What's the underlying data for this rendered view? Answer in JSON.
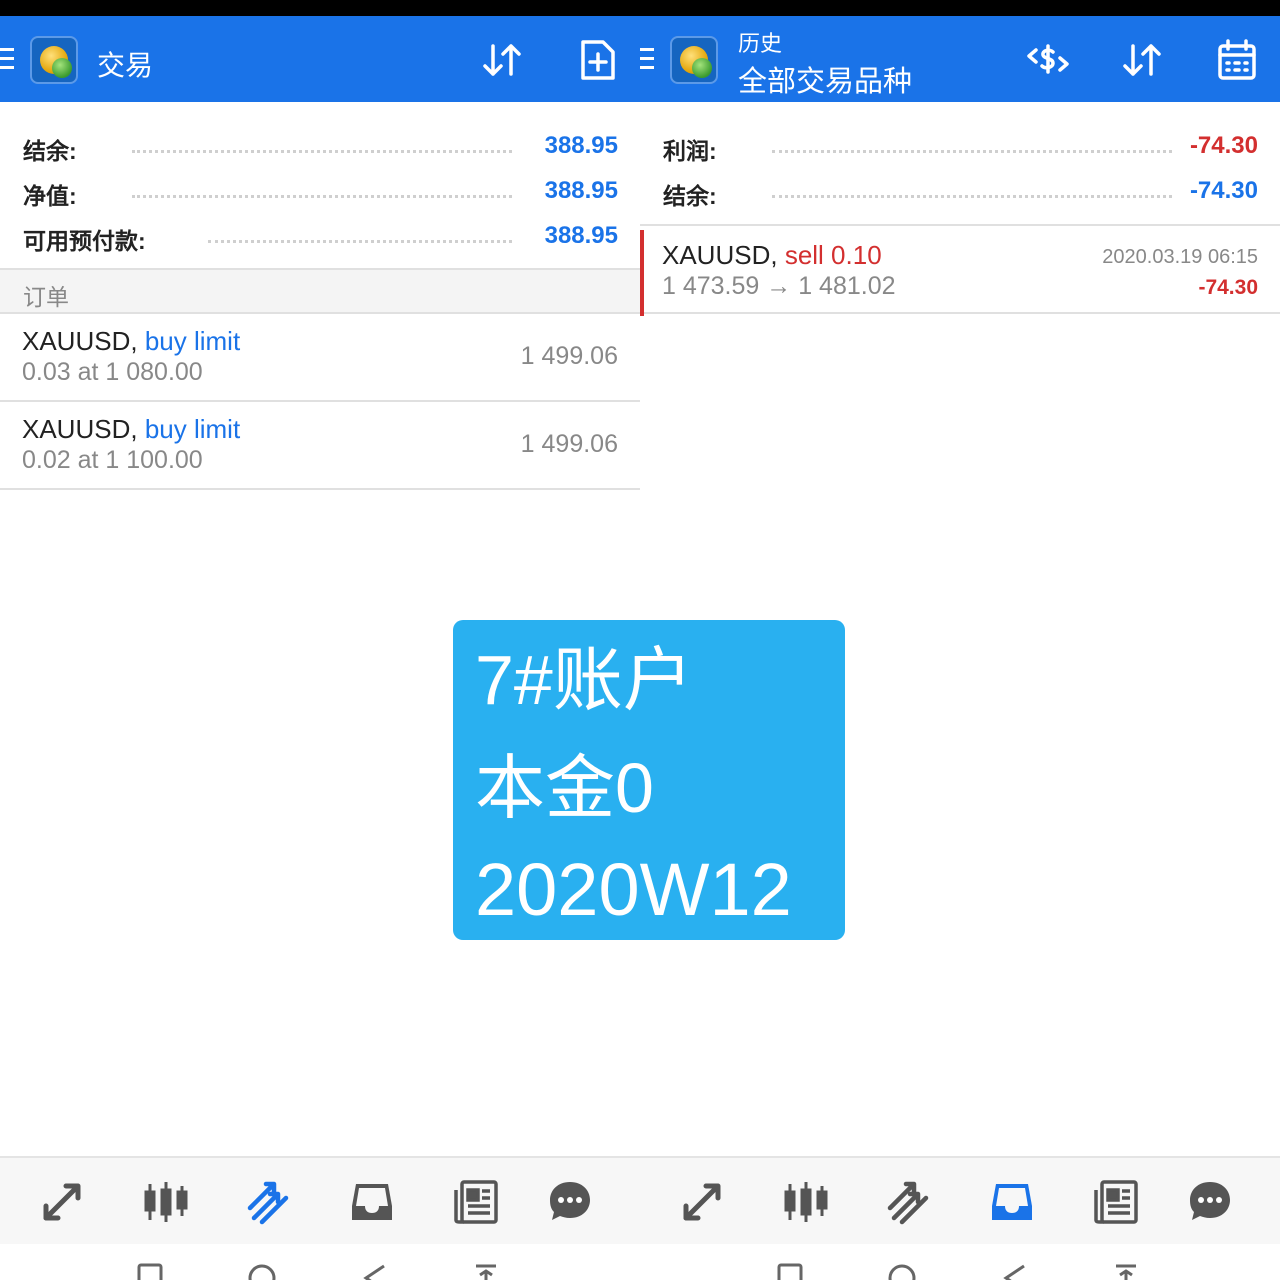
{
  "left_pane": {
    "title": "交易",
    "summary": [
      {
        "label": "结余:",
        "value": "388.95"
      },
      {
        "label": "净值:",
        "value": "388.95"
      },
      {
        "label": "可用预付款:",
        "value": "388.95"
      }
    ],
    "section_title": "订单",
    "orders": [
      {
        "symbol": "XAUUSD,",
        "type": "buy limit",
        "detail": "0.03 at 1 080.00",
        "price": "1 499.06"
      },
      {
        "symbol": "XAUUSD,",
        "type": "buy limit",
        "detail": "0.02 at 1 100.00",
        "price": "1 499.06"
      }
    ]
  },
  "right_pane": {
    "title": "历史",
    "subtitle": "全部交易品种",
    "summary": [
      {
        "label": "利润:",
        "value": "-74.30"
      },
      {
        "label": "结余:",
        "value": "-74.30"
      }
    ],
    "deals": [
      {
        "symbol": "XAUUSD,",
        "type": "sell 0.10",
        "detail": "1 473.59 → 1 481.02",
        "time": "2020.03.19 06:15",
        "profit": "-74.30"
      }
    ]
  },
  "overlay": {
    "line1": "7#账户",
    "line2": "本金0",
    "line3": "2020W12"
  },
  "bottom_nav": {
    "items": [
      "quotes-icon",
      "chart-icon",
      "trade-icon",
      "history-icon",
      "news-icon",
      "chat-icon"
    ],
    "left_active": "trade-icon",
    "right_active": "history-icon"
  },
  "colors": {
    "app_bar": "#1a73e8",
    "positive_blue": "#1a73e8",
    "negative_red": "#d32f2f",
    "overlay": "#29b0f0",
    "nav_inactive": "#555555"
  }
}
